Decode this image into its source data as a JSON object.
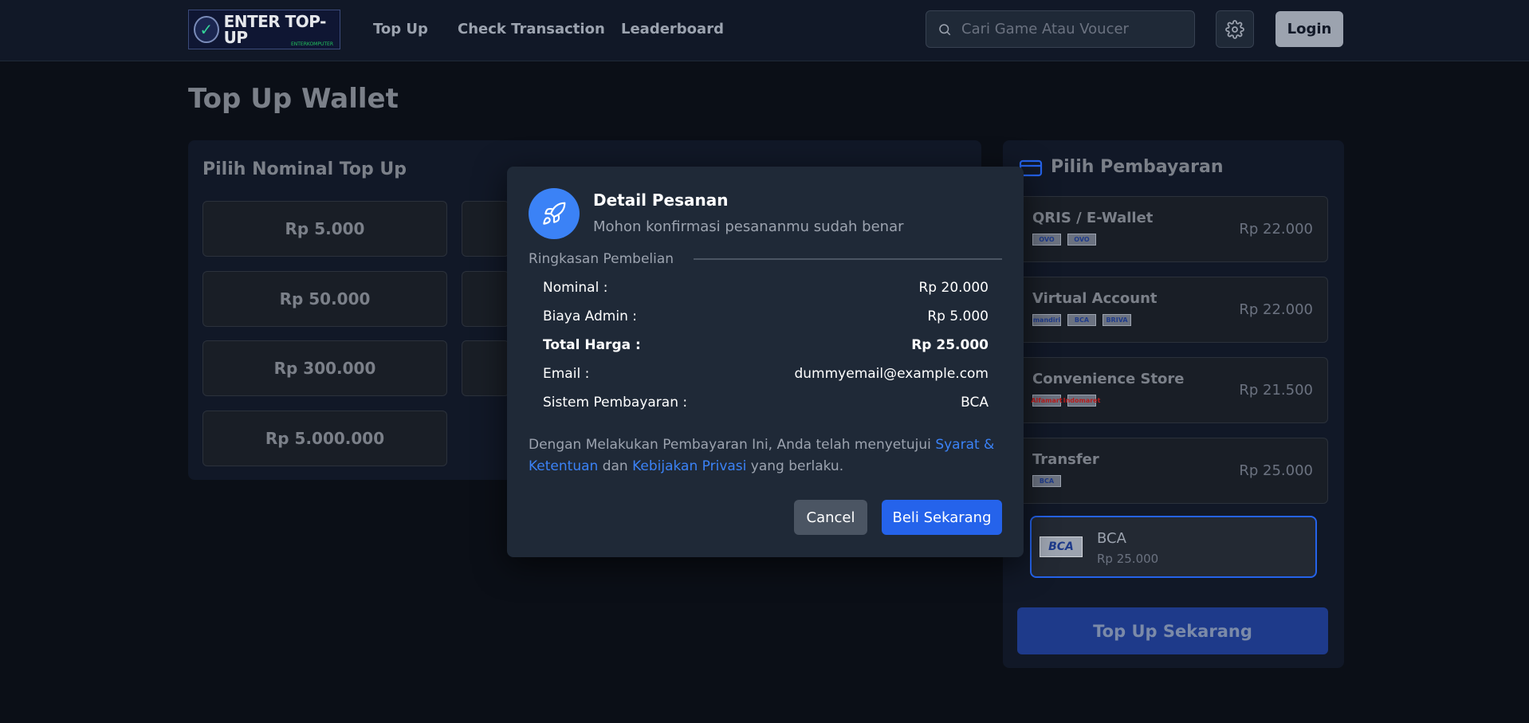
{
  "header": {
    "logo_text": "ENTER TOP-UP",
    "logo_sub": "ENTERKOMPUTER",
    "nav": [
      "Top Up",
      "Check Transaction",
      "Leaderboard"
    ],
    "search_placeholder": "Cari Game Atau Voucer",
    "login_label": "Login"
  },
  "page_title": "Top Up Wallet",
  "nominal": {
    "title": "Pilih Nominal Top Up",
    "options": [
      "Rp 5.000",
      "Rp 50.000",
      "Rp 300.000",
      "Rp 5.000.000"
    ]
  },
  "payment": {
    "title": "Pilih Pembayaran",
    "categories": [
      {
        "name": "QRIS / E-Wallet",
        "price": "Rp 22.000",
        "logos": [
          "OVO",
          "OVO"
        ]
      },
      {
        "name": "Virtual Account",
        "price": "Rp 22.000",
        "logos": [
          "mandiri",
          "BCA",
          "BRIVA"
        ]
      },
      {
        "name": "Convenience Store",
        "price": "Rp 21.500",
        "logos": [
          "Alfamart",
          "Indomaret"
        ]
      },
      {
        "name": "Transfer",
        "price": "Rp 25.000",
        "logos": [
          "BCA"
        ]
      }
    ],
    "selected": {
      "logo": "BCA",
      "name": "BCA",
      "price": "Rp 25.000"
    },
    "submit_label": "Top Up Sekarang"
  },
  "modal": {
    "title": "Detail Pesanan",
    "subtitle": "Mohon konfirmasi pesananmu sudah benar",
    "summary_label": "Ringkasan Pembelian",
    "rows": [
      {
        "label": "Nominal :",
        "value": "Rp 20.000"
      },
      {
        "label": "Biaya Admin :",
        "value": "Rp 5.000"
      },
      {
        "label": "Total Harga :",
        "value": "Rp 25.000"
      },
      {
        "label": "Email :",
        "value": "dummyemail@example.com"
      },
      {
        "label": "Sistem Pembayaran :",
        "value": "BCA"
      }
    ],
    "terms_prefix": "Dengan Melakukan Pembayaran Ini, Anda telah menyetujui ",
    "terms_link": "Syarat & Ketentuan",
    "terms_mid": " dan ",
    "privacy_link": "Kebijakan Privasi",
    "terms_suffix": " yang berlaku.",
    "cancel_label": "Cancel",
    "confirm_label": "Beli Sekarang"
  },
  "colors": {
    "accent": "#2563eb",
    "background": "#0b0f17",
    "modal_bg": "#1f2937"
  }
}
